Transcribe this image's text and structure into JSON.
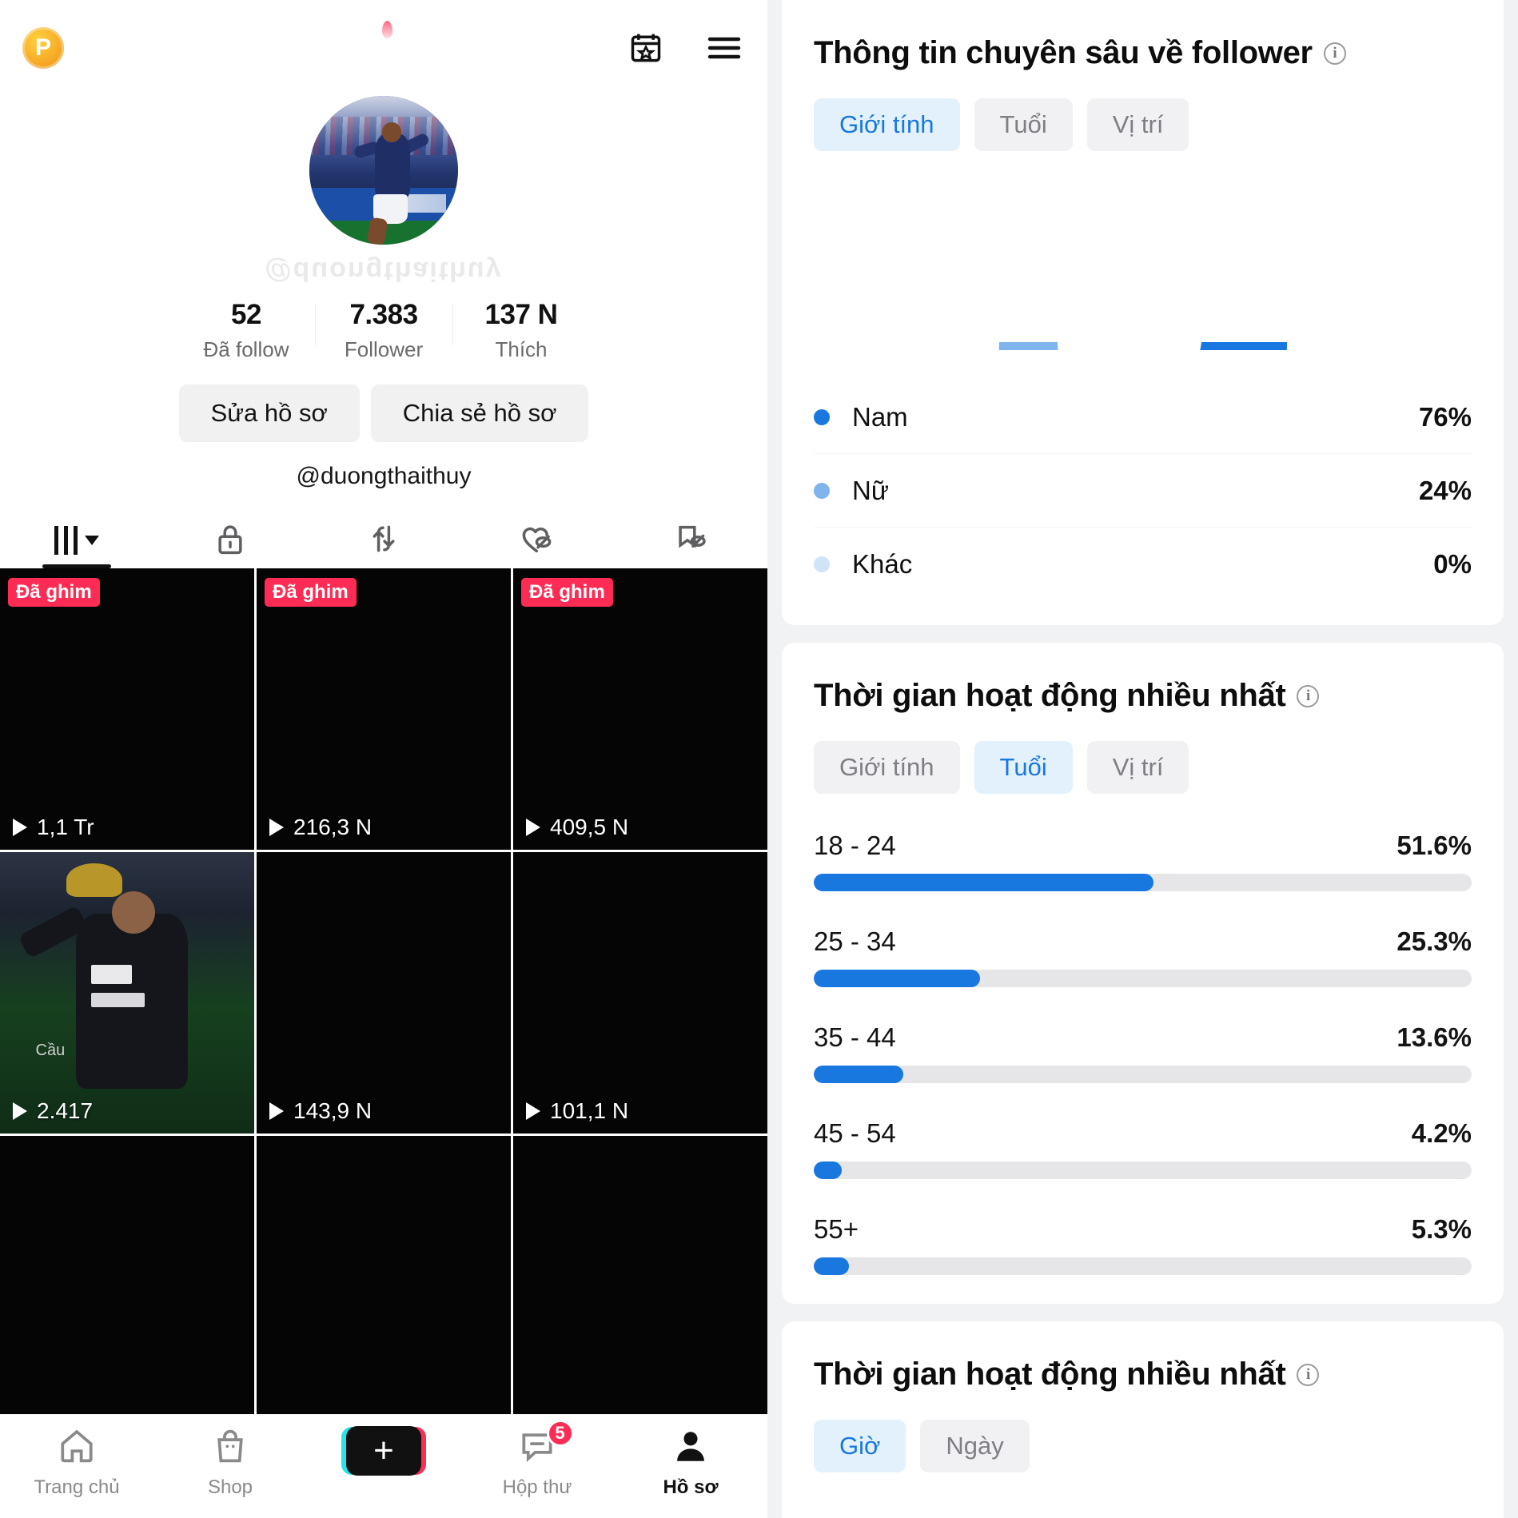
{
  "colors": {
    "accent_blue": "#1878e0",
    "accent_blue_light": "#7fb5ec",
    "accent_blue_pale": "#cfe4f8",
    "pink": "#fe2c55",
    "seg_active_bg": "#e3f1fd",
    "track_gray": "#e6e6e8"
  },
  "phone": {
    "topbar": {
      "coin_label": "P",
      "coin_icon": "coin-p-icon",
      "calendar_star_icon": "calendar-star-icon",
      "menu_icon": "hamburger-menu-icon"
    },
    "avatar_name": "avatar",
    "watermark_text": "@duongthaithuy",
    "stats": [
      {
        "value": "52",
        "label": "Đã follow"
      },
      {
        "value": "7.383",
        "label": "Follower"
      },
      {
        "value": "137 N",
        "label": "Thích"
      }
    ],
    "buttons": {
      "edit_profile": "Sửa hồ sơ",
      "share_profile": "Chia sẻ hồ sơ"
    },
    "handle": "@duongthaithuy",
    "tabs": [
      {
        "name": "posts-grid",
        "icon": "grid-columns-icon",
        "active": true
      },
      {
        "name": "private",
        "icon": "lock-icon",
        "active": false
      },
      {
        "name": "reposts",
        "icon": "repost-arrows-icon",
        "active": false
      },
      {
        "name": "liked-hidden",
        "icon": "heart-eye-slash-icon",
        "active": false
      },
      {
        "name": "saved-hidden",
        "icon": "bookmark-eye-slash-icon",
        "active": false
      }
    ],
    "pin_label": "Đã ghim",
    "videos": [
      {
        "pinned": true,
        "views": "1,1 Tr",
        "thumb": "dark"
      },
      {
        "pinned": true,
        "views": "216,3 N",
        "thumb": "dark"
      },
      {
        "pinned": true,
        "views": "409,5 N",
        "thumb": "dark"
      },
      {
        "pinned": false,
        "views": "2.417",
        "thumb": "madrid"
      },
      {
        "pinned": false,
        "views": "143,9 N",
        "thumb": "dark"
      },
      {
        "pinned": false,
        "views": "101,1 N",
        "thumb": "dark"
      },
      {
        "pinned": false,
        "views": "",
        "thumb": "dark"
      },
      {
        "pinned": false,
        "views": "",
        "thumb": "dark"
      },
      {
        "pinned": false,
        "views": "",
        "thumb": "dark"
      }
    ],
    "bottom_nav": [
      {
        "label": "Trang chủ",
        "icon": "home-icon",
        "active": false,
        "badge": ""
      },
      {
        "label": "Shop",
        "icon": "shop-bag-icon",
        "active": false,
        "badge": ""
      },
      {
        "label": "",
        "icon": "plus-create-icon",
        "active": false,
        "badge": ""
      },
      {
        "label": "Hộp thư",
        "icon": "inbox-message-icon",
        "active": false,
        "badge": "5"
      },
      {
        "label": "Hồ sơ",
        "icon": "person-profile-icon",
        "active": true,
        "badge": ""
      }
    ]
  },
  "analytics": {
    "follower_insights": {
      "title": "Thông tin chuyên sâu về follower",
      "info_icon": "info-circle-icon",
      "segments": [
        {
          "label": "Giới tính",
          "active": true
        },
        {
          "label": "Tuổi",
          "active": false
        },
        {
          "label": "Vị trí",
          "active": false
        }
      ],
      "legend": [
        {
          "label": "Nam",
          "value": "76%",
          "color": "#1878e0"
        },
        {
          "label": "Nữ",
          "value": "24%",
          "color": "#7fb5ec"
        },
        {
          "label": "Khác",
          "value": "0%",
          "color": "#cfe4f8"
        }
      ]
    },
    "most_active_age": {
      "title": "Thời gian hoạt động nhiều nhất",
      "info_icon": "info-circle-icon",
      "segments": [
        {
          "label": "Giới tính",
          "active": false
        },
        {
          "label": "Tuổi",
          "active": true
        },
        {
          "label": "Vị trí",
          "active": false
        }
      ]
    },
    "most_active_time": {
      "title": "Thời gian hoạt động nhiều nhất",
      "info_icon": "info-circle-icon",
      "segments": [
        {
          "label": "Giờ",
          "active": true
        },
        {
          "label": "Ngày",
          "active": false
        }
      ]
    }
  },
  "chart_data": [
    {
      "type": "pie",
      "title": "Thông tin chuyên sâu về follower",
      "subtitle": "Giới tính",
      "variant": "semicircle-donut",
      "labels": [
        "Nam",
        "Nữ",
        "Khác"
      ],
      "values": [
        76,
        24,
        0
      ],
      "value_labels": [
        "76%",
        "24%",
        "0%"
      ],
      "colors": [
        "#1878e0",
        "#7fb5ec",
        "#cfe4f8"
      ],
      "legend": "bottom",
      "grid": false
    },
    {
      "type": "bar",
      "title": "Thời gian hoạt động nhiều nhất",
      "subtitle": "Tuổi",
      "orientation": "horizontal",
      "categories": [
        "18 - 24",
        "25 - 34",
        "35 - 44",
        "45 - 54",
        "55+"
      ],
      "values": [
        51.6,
        25.3,
        13.6,
        4.2,
        5.3
      ],
      "value_labels": [
        "51.6%",
        "25.3%",
        "13.6%",
        "4.2%",
        "5.3%"
      ],
      "xlabel": "",
      "ylabel": "",
      "xlim": [
        0,
        100
      ],
      "bar_color": "#1878e0",
      "track_color": "#e6e6e8",
      "grid": false,
      "legend": "none"
    }
  ]
}
